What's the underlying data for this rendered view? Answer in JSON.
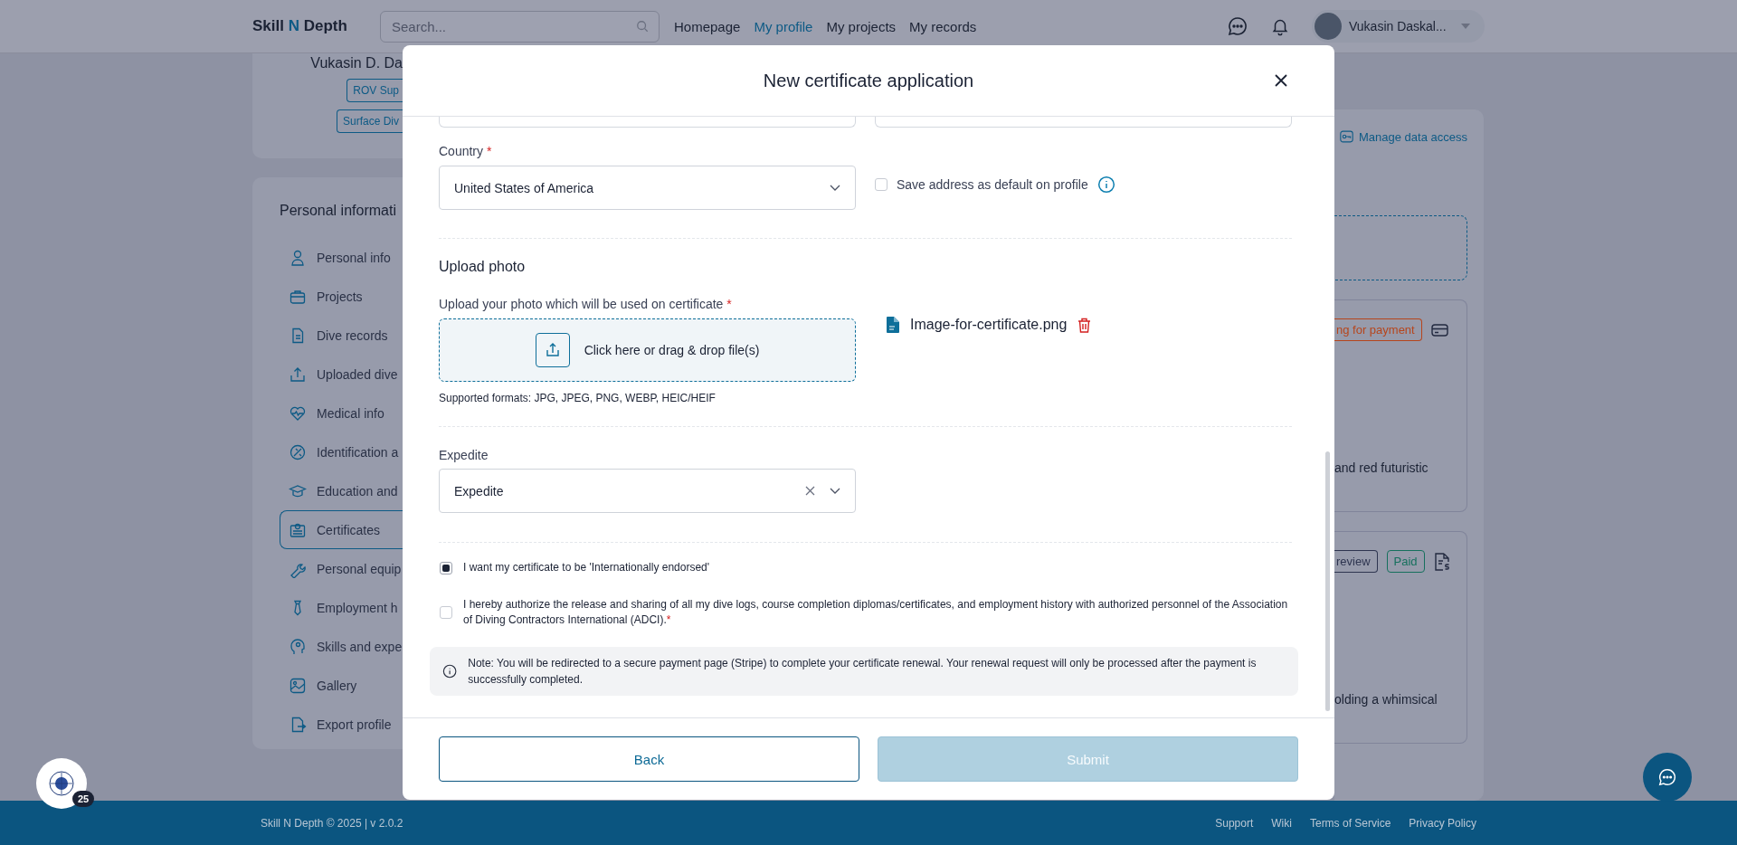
{
  "header": {
    "logo": {
      "before": "Skill",
      "accent": "N",
      "after": "Depth"
    },
    "search": {
      "placeholder": "Search..."
    },
    "nav": [
      {
        "label": "Homepage",
        "selected": false
      },
      {
        "label": "My profile",
        "selected": true
      },
      {
        "label": "My projects",
        "selected": false
      },
      {
        "label": "My records",
        "selected": false
      }
    ],
    "user": {
      "name": "Vukasin Daskal..."
    }
  },
  "profile_card": {
    "name": "Vukasin D. Da",
    "tags": [
      "ROV Sup",
      "Surface Div"
    ]
  },
  "sidebar": {
    "title": "Personal informati",
    "items": [
      {
        "label": "Personal info",
        "selected": false
      },
      {
        "label": "Projects",
        "selected": false
      },
      {
        "label": "Dive records",
        "selected": false
      },
      {
        "label": "Uploaded dive",
        "selected": false
      },
      {
        "label": "Medical info",
        "selected": false
      },
      {
        "label": "Identification a",
        "selected": false
      },
      {
        "label": "Education and",
        "selected": false
      },
      {
        "label": "Certificates",
        "selected": true
      },
      {
        "label": "Personal equip",
        "selected": false
      },
      {
        "label": "Employment h",
        "selected": false
      },
      {
        "label": "Skills and expe",
        "selected": false
      },
      {
        "label": "Gallery",
        "selected": false
      },
      {
        "label": "Export profile",
        "selected": false
      }
    ]
  },
  "right_panel": {
    "link": "Manage data access",
    "cards": [
      {
        "badges": [
          {
            "text": "ng for payment",
            "kind": "warning"
          }
        ],
        "snippet": "and red futuristic"
      },
      {
        "badges": [
          {
            "text": "review",
            "kind": "neutral"
          },
          {
            "text": "Paid",
            "kind": "success"
          }
        ],
        "snippet": "olding a whimsical"
      }
    ]
  },
  "modal": {
    "title": "New certificate application",
    "country": {
      "label": "Country",
      "required_mark": "*",
      "value": "United States of America"
    },
    "save_default": {
      "label": "Save address as default on profile",
      "checked": false
    },
    "upload": {
      "heading": "Upload photo",
      "label": "Upload your photo which will be used on certificate",
      "required_mark": "*",
      "dropzone": "Click here or drag & drop file(s)",
      "formats": "Supported formats: JPG, JPEG, PNG, WEBP, HEIC/HEIF",
      "files": [
        {
          "name": "Image-for-certificate.png"
        }
      ]
    },
    "expedite": {
      "label": "Expedite",
      "value": "Expedite"
    },
    "consents": [
      {
        "text": "I want my certificate to be 'Internationally endorsed'",
        "checked": true
      },
      {
        "text": "I hereby authorize the release and sharing of all my dive logs, course completion diplomas/certificates, and employment history with authorized personnel of the Association of Diving Contractors International (ADCI).",
        "checked": false,
        "required_mark": "*"
      }
    ],
    "note": "Note: You will be redirected to a secure payment page (Stripe) to complete your certificate renewal. Your renewal request will only be processed after the payment is successfully completed.",
    "buttons": [
      {
        "label": "Back",
        "kind": "secondary",
        "disabled": false
      },
      {
        "label": "Submit",
        "kind": "primary",
        "disabled": true
      }
    ]
  },
  "footer": {
    "copyright": "Skill N Depth © 2025 | v 2.0.2",
    "links": [
      "Support",
      "Wiki",
      "Terms of Service",
      "Privacy Policy"
    ]
  },
  "widgets": {
    "badge_count": "25"
  }
}
